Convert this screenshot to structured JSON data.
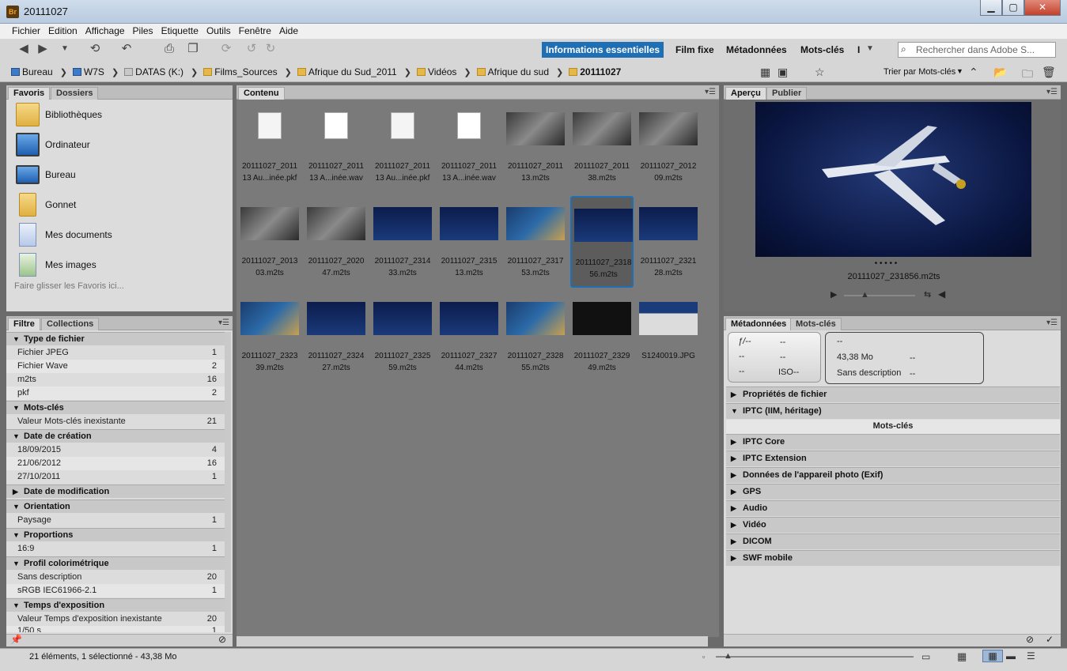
{
  "window": {
    "title": "20111027",
    "app_badge": "Br",
    "minimize": "▁",
    "maximize": "▢",
    "close": "✕"
  },
  "menu": [
    "Fichier",
    "Edition",
    "Affichage",
    "Piles",
    "Etiquette",
    "Outils",
    "Fenêtre",
    "Aide"
  ],
  "workspaces": [
    "Informations essentielles",
    "Film fixe",
    "Métadonnées",
    "Mots-clés",
    "I"
  ],
  "search": {
    "placeholder": "Rechercher dans Adobe S..."
  },
  "breadcrumb": [
    "Bureau",
    "W7S",
    "DATAS (K:)",
    "Films_Sources",
    "Afrique du Sud_2011",
    "Vidéos",
    "Afrique du sud",
    "20111027"
  ],
  "sort": {
    "label": "Trier par Mots-clés"
  },
  "left_tabs": {
    "favorites": "Favoris",
    "folders": "Dossiers"
  },
  "favorites": [
    {
      "label": "Bibliothèques",
      "icon": "libraries-icon"
    },
    {
      "label": "Ordinateur",
      "icon": "computer-icon"
    },
    {
      "label": "Bureau",
      "icon": "desktop-icon"
    },
    {
      "label": "Gonnet",
      "icon": "user-folder-icon"
    },
    {
      "label": "Mes documents",
      "icon": "documents-icon"
    },
    {
      "label": "Mes images",
      "icon": "pictures-icon"
    }
  ],
  "favorites_hint": "Faire glisser les Favoris ici...",
  "filter_tabs": {
    "filter": "Filtre",
    "collections": "Collections"
  },
  "filters": [
    {
      "head": "Type de fichier",
      "open": true,
      "rows": [
        [
          "Fichier JPEG",
          "1"
        ],
        [
          "Fichier Wave",
          "2"
        ],
        [
          "m2ts",
          "16"
        ],
        [
          "pkf",
          "2"
        ]
      ]
    },
    {
      "head": "Mots-clés",
      "open": true,
      "rows": [
        [
          "Valeur Mots-clés inexistante",
          "21"
        ]
      ]
    },
    {
      "head": "Date de création",
      "open": true,
      "rows": [
        [
          "18/09/2015",
          "4"
        ],
        [
          "21/06/2012",
          "16"
        ],
        [
          "27/10/2011",
          "1"
        ]
      ]
    },
    {
      "head": "Date de modification",
      "open": false,
      "rows": []
    },
    {
      "head": "Orientation",
      "open": true,
      "rows": [
        [
          "Paysage",
          "1"
        ]
      ]
    },
    {
      "head": "Proportions",
      "open": true,
      "rows": [
        [
          "16:9",
          "1"
        ]
      ]
    },
    {
      "head": "Profil colorimétrique",
      "open": true,
      "rows": [
        [
          "Sans description",
          "20"
        ],
        [
          "sRGB IEC61966-2.1",
          "1"
        ]
      ]
    },
    {
      "head": "Temps d'exposition",
      "open": true,
      "rows": [
        [
          "Valeur Temps d'exposition inexistante",
          "20"
        ],
        [
          "1/50 s",
          "1"
        ]
      ]
    }
  ],
  "content_tab": "Contenu",
  "thumbnails": [
    {
      "line1": "20111027_2011",
      "line2": "13 Au...inée.pkf",
      "kind": "prf"
    },
    {
      "line1": "20111027_2011",
      "line2": "13 A...inée.wav",
      "kind": "wav"
    },
    {
      "line1": "20111027_2011",
      "line2": "13 Au...inée.pkf",
      "kind": "prf"
    },
    {
      "line1": "20111027_2011",
      "line2": "13 A...inée.wav",
      "kind": "wav"
    },
    {
      "line1": "20111027_2011",
      "line2": "13.m2ts",
      "kind": "dark"
    },
    {
      "line1": "20111027_2011",
      "line2": "38.m2ts",
      "kind": "dark"
    },
    {
      "line1": "20111027_2012",
      "line2": "09.m2ts",
      "kind": "dark"
    },
    {
      "line1": "20111027_2013",
      "line2": "03.m2ts",
      "kind": "dark"
    },
    {
      "line1": "20111027_2020",
      "line2": "47.m2ts",
      "kind": "dark"
    },
    {
      "line1": "20111027_2314",
      "line2": "33.m2ts",
      "kind": "blue"
    },
    {
      "line1": "20111027_2315",
      "line2": "13.m2ts",
      "kind": "blue"
    },
    {
      "line1": "20111027_2317",
      "line2": "53.m2ts",
      "kind": "map"
    },
    {
      "line1": "20111027_2318",
      "line2": "56.m2ts",
      "kind": "blue",
      "selected": true
    },
    {
      "line1": "20111027_2321",
      "line2": "28.m2ts",
      "kind": "blue"
    },
    {
      "line1": "20111027_2323",
      "line2": "39.m2ts",
      "kind": "map"
    },
    {
      "line1": "20111027_2324",
      "line2": "27.m2ts",
      "kind": "blue"
    },
    {
      "line1": "20111027_2325",
      "line2": "59.m2ts",
      "kind": "blue"
    },
    {
      "line1": "20111027_2327",
      "line2": "44.m2ts",
      "kind": "blue"
    },
    {
      "line1": "20111027_2328",
      "line2": "55.m2ts",
      "kind": "map"
    },
    {
      "line1": "20111027_2329",
      "line2": "49.m2ts",
      "kind": "dark"
    },
    {
      "line1": "S1240019.JPG",
      "line2": "",
      "kind": "photo"
    }
  ],
  "preview_tabs": {
    "preview": "Aperçu",
    "publish": "Publier"
  },
  "preview": {
    "filename": "20111027_231856.m2ts",
    "dots": "• • • • •"
  },
  "meta_tabs": {
    "metadata": "Métadonnées",
    "keywords": "Mots-clés"
  },
  "meta_box_left": {
    "aperture": "ƒ/--",
    "a2": "--",
    "r2a": "--",
    "r2b": "--",
    "r3a": "--",
    "iso": "ISO--"
  },
  "meta_box_right": {
    "r1": "--",
    "size": "43,38 Mo",
    "size_v": "--",
    "profile": "Sans description",
    "profile_v": "--"
  },
  "meta_sections": [
    {
      "label": "Propriétés de fichier",
      "open": false
    },
    {
      "label": "IPTC (IIM, héritage)",
      "open": true
    },
    {
      "label": "IPTC Core",
      "open": false
    },
    {
      "label": "IPTC Extension",
      "open": false
    },
    {
      "label": "Données de l'appareil photo (Exif)",
      "open": false
    },
    {
      "label": "GPS",
      "open": false
    },
    {
      "label": "Audio",
      "open": false
    },
    {
      "label": "Vidéo",
      "open": false
    },
    {
      "label": "DICOM",
      "open": false
    },
    {
      "label": "SWF mobile",
      "open": false
    }
  ],
  "meta_keywords_label": "Mots-clés",
  "status": {
    "text": "21 éléments, 1 sélectionné - 43,38 Mo"
  },
  "thumb_slider": {
    "value_fraction": 0.06
  }
}
